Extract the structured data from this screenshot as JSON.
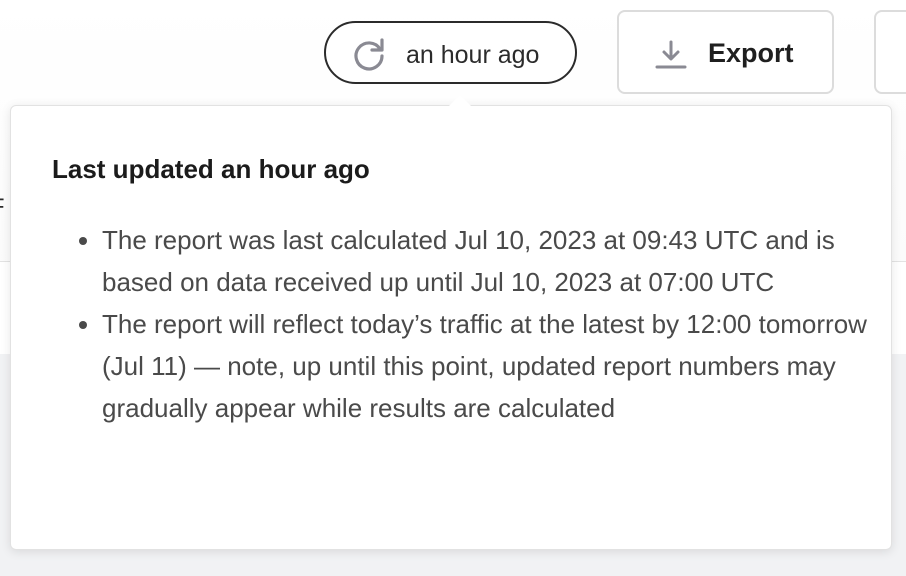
{
  "toolbar": {
    "refresh_label": "an hour ago",
    "export_label": "Export"
  },
  "background": {
    "clipped_text": "F"
  },
  "popover": {
    "title": "Last updated an hour ago",
    "items": [
      {
        "text": "The report was last calculated Jul 10, 2023 at 09:43 UTC and is based on data received up until Jul 10, 2023 at 07:00 UTC"
      },
      {
        "text": "The report will reflect today’s traffic at the latest by 12:00 tomorrow (Jul 11) — note, up until this point, updated report numbers may gradually appear while results are calculated"
      }
    ]
  },
  "icons": {
    "refresh": "refresh-icon",
    "export": "download-icon"
  },
  "colors": {
    "text_primary": "#1f1f1f",
    "text_secondary": "#4a4a4a",
    "icon_gray": "#8a8a93",
    "border_dark": "#2b2b2b",
    "border_light": "#dcdcdc",
    "page_bg_lower": "#f1f2f4"
  }
}
